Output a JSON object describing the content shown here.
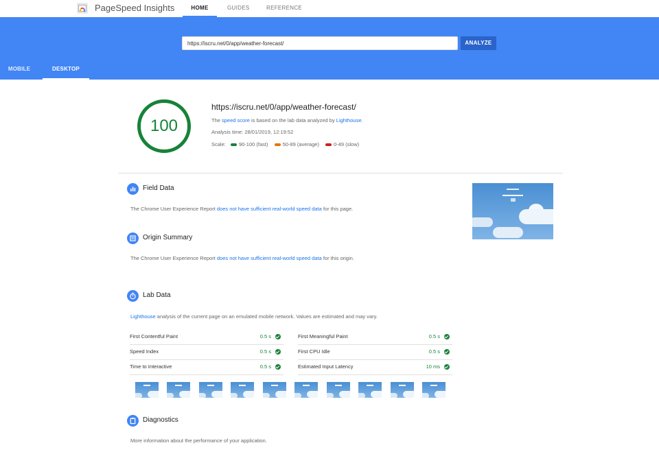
{
  "header": {
    "app_title": "PageSpeed Insights",
    "nav": [
      {
        "label": "HOME",
        "active": true
      },
      {
        "label": "GUIDES",
        "active": false
      },
      {
        "label": "REFERENCE",
        "active": false
      }
    ]
  },
  "search": {
    "value": "https://iscru.net/0/app/weather-forecast/",
    "analyze_label": "ANALYZE"
  },
  "device_tabs": [
    {
      "label": "MOBILE",
      "active": false
    },
    {
      "label": "DESKTOP",
      "active": true
    }
  ],
  "summary": {
    "score": "100",
    "score_color": "#178239",
    "url": "https://iscru.net/0/app/weather-forecast/",
    "desc_prefix": "The ",
    "desc_link1": "speed score",
    "desc_mid": " is based on the lab data analyzed by ",
    "desc_link2": "Lighthouse",
    "desc_suffix": ".",
    "analysis_time": "Analysis time: 28/01/2019, 12:19:52",
    "scale_label": "Scale:",
    "scale": [
      {
        "label": "90-100 (fast)",
        "color": "#178239"
      },
      {
        "label": "50-89 (average)",
        "color": "#e67700"
      },
      {
        "label": "0-49 (slow)",
        "color": "#c7221f"
      }
    ]
  },
  "field_data": {
    "title": "Field Data",
    "icon": "bar-chart-icon",
    "text_prefix": "The Chrome User Experience Report ",
    "text_link": "does not have sufficient real-world speed data",
    "text_suffix": " for this page."
  },
  "origin_summary": {
    "title": "Origin Summary",
    "icon": "document-icon",
    "text_prefix": "The Chrome User Experience Report ",
    "text_link": "does not have sufficient real-world speed data",
    "text_suffix": " for this origin."
  },
  "lab_data": {
    "title": "Lab Data",
    "icon": "stopwatch-icon",
    "text_link": "Lighthouse",
    "text_suffix": " analysis of the current page on an emulated mobile network. Values are estimated and may vary.",
    "metrics": [
      {
        "label": "First Contentful Paint",
        "value": "0.5 s"
      },
      {
        "label": "First Meaningful Paint",
        "value": "0.5 s"
      },
      {
        "label": "Speed Index",
        "value": "0.5 s"
      },
      {
        "label": "First CPU Idle",
        "value": "0.5 s"
      },
      {
        "label": "Time to Interactive",
        "value": "0.5 s"
      },
      {
        "label": "Estimated Input Latency",
        "value": "10 ms"
      }
    ]
  },
  "diagnostics": {
    "title": "Diagnostics",
    "icon": "clipboard-icon",
    "text": "More information about the performance of your application."
  }
}
